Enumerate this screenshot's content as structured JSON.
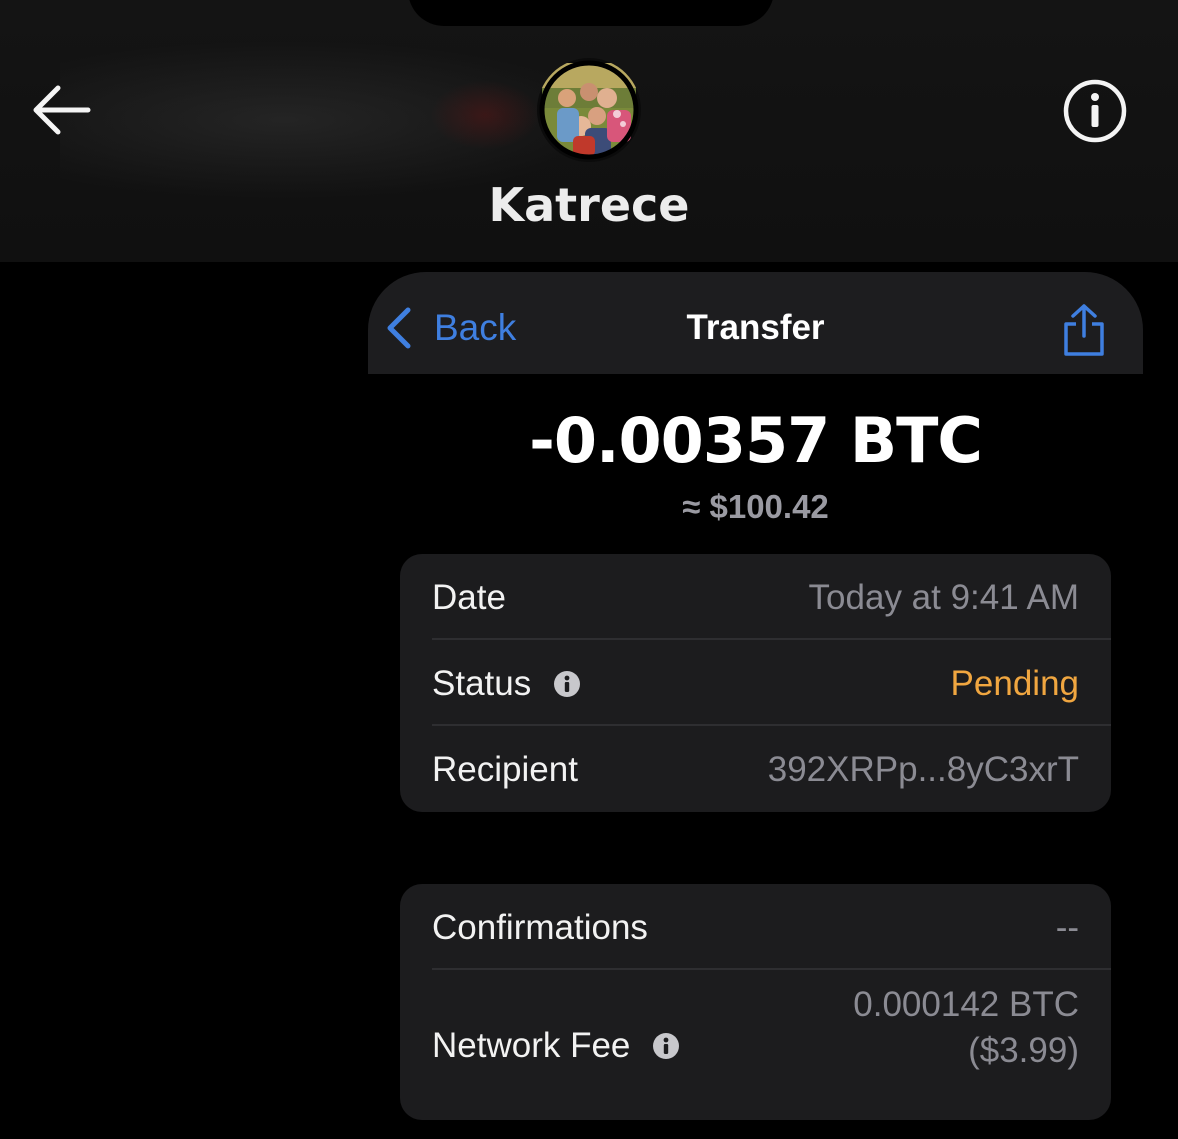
{
  "conversation": {
    "contact_name": "Katrece",
    "avatar_alt": "contact photo"
  },
  "transfer": {
    "nav": {
      "back_label": "Back",
      "title": "Transfer"
    },
    "amount": "-0.00357 BTC",
    "fiat_amount": "≈ $100.42",
    "details": [
      {
        "label": "Date",
        "value": "Today at 9:41 AM"
      },
      {
        "label": "Status",
        "value": "Pending",
        "status_color": "#f0a640"
      },
      {
        "label": "Recipient",
        "value": "392XRPp...8yC3xrT"
      }
    ],
    "network": [
      {
        "label": "Confirmations",
        "value": "--"
      },
      {
        "label": "Network Fee",
        "value_line1": "0.000142 BTC",
        "value_line2": "($3.99)"
      }
    ]
  },
  "icons": {
    "back": "arrow-left-icon",
    "info": "info-circle-icon",
    "nav_back": "chevron-left-icon",
    "share": "share-icon",
    "status_info": "info-dot-icon"
  },
  "colors": {
    "accent": "#3f7fe0",
    "pending": "#f0a640",
    "card": "#1c1c1e"
  }
}
